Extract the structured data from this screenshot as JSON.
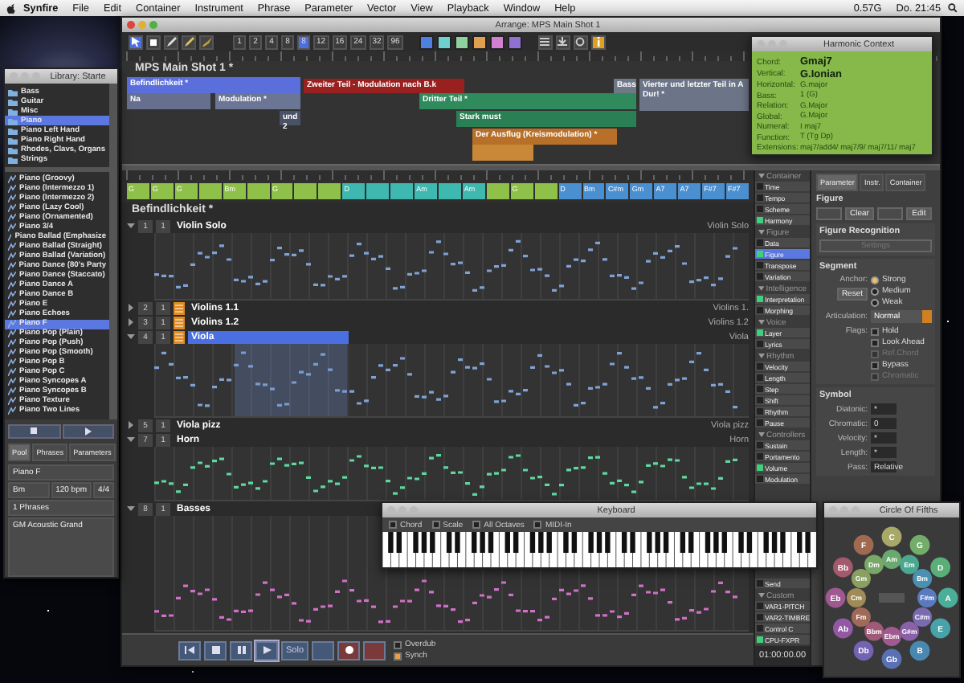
{
  "menu_bar": {
    "app": "Synfire",
    "items": [
      "File",
      "Edit",
      "Container",
      "Instrument",
      "Phrase",
      "Parameter",
      "Vector",
      "View",
      "Playback",
      "Window",
      "Help"
    ],
    "memory": "0.57G",
    "clock": "Do. 21:45"
  },
  "arrange_window": {
    "title": "Arrange: MPS Main Shot 1",
    "toolbar": {
      "quantize": [
        {
          "label": "1",
          "selected": false
        },
        {
          "label": "2",
          "selected": false
        },
        {
          "label": "4",
          "selected": false
        },
        {
          "label": "8",
          "selected": false
        },
        {
          "label": "8",
          "selected": true
        },
        {
          "label": "12",
          "selected": false
        },
        {
          "label": "16",
          "selected": false
        },
        {
          "label": "24",
          "selected": false
        },
        {
          "label": "32",
          "selected": false
        },
        {
          "label": "96",
          "selected": false
        }
      ],
      "color_buttons": [
        {
          "color": "#4f7fe0"
        },
        {
          "color": "#6fd0d0"
        },
        {
          "color": "#8fd0a0"
        },
        {
          "color": "#e0a050"
        },
        {
          "color": "#d080d0"
        },
        {
          "color": "#9070d0"
        }
      ]
    },
    "arrange": {
      "title": "MPS Main Shot 1 *",
      "blocks": [
        {
          "label": "Befindlichkeit *",
          "color": "#5b6fdc"
        },
        {
          "label": "Zweiter Teil - Modulation nach B.k",
          "color": "#9a2020"
        },
        {
          "label": "Na",
          "color": "#66708e"
        },
        {
          "label": "Modulation *",
          "color": "#6b7594"
        },
        {
          "label": "und 2",
          "color": "#4a5266"
        },
        {
          "label": "Dritter Teil *",
          "color": "#2f8a5c"
        },
        {
          "label": "Stark must",
          "color": "#2a7f55"
        },
        {
          "label": "Der Ausflug (Kreismodulation) *",
          "color": "#b87028"
        },
        {
          "label": "Bass",
          "color": "#707888"
        },
        {
          "label": "Vierter und letzter Teil in A Dur! *",
          "color": "#6c7488"
        }
      ]
    },
    "chords": [
      {
        "label": "G",
        "color": "#8fc04a"
      },
      {
        "label": "G",
        "color": "#8fc04a"
      },
      {
        "label": "G",
        "color": "#8fc04a"
      },
      {
        "color": "#8fc04a"
      },
      {
        "label": "Bm",
        "color": "#8fc04a"
      },
      {
        "color": "#8fc04a"
      },
      {
        "label": "G",
        "color": "#8fc04a"
      },
      {
        "color": "#8fc04a"
      },
      {
        "color": "#8fc04a"
      },
      {
        "label": "D",
        "color": "#3fb8b0"
      },
      {
        "color": "#3fb8b0"
      },
      {
        "color": "#3fb8b0"
      },
      {
        "label": "Am",
        "color": "#3fb8b0"
      },
      {
        "color": "#3fb8b0"
      },
      {
        "label": "Am",
        "color": "#3fb8b0"
      },
      {
        "color": "#8fc04a"
      },
      {
        "label": "G",
        "color": "#8fc04a"
      },
      {
        "color": "#8fc04a"
      },
      {
        "label": "D",
        "color": "#4a8fd0"
      },
      {
        "label": "Bm",
        "color": "#4a8fd0"
      },
      {
        "label": "C#m",
        "color": "#4a8fd0"
      },
      {
        "label": "Gm",
        "color": "#4a8fd0"
      },
      {
        "label": "A7",
        "color": "#4a8fd0"
      },
      {
        "label": "A7",
        "color": "#4a8fd0"
      },
      {
        "label": "F#7",
        "color": "#4a8fd0"
      },
      {
        "label": "F#7",
        "color": "#4a8fd0"
      }
    ],
    "section_title": "Befindlichkeit *",
    "tracks": [
      {
        "number": "1",
        "channel": "1",
        "name": "Violin Solo",
        "right_label": "Violin Solo",
        "grouped": false,
        "expanded": true,
        "selected": false,
        "color": "#7fa2d6"
      },
      {
        "number": "2",
        "channel": "1",
        "name": "Violins 1.1",
        "right_label": "Violins 1.",
        "grouped": true,
        "expanded": false,
        "selected": false
      },
      {
        "number": "3",
        "channel": "1",
        "name": "Violins 1.2",
        "right_label": "Violins 1.2",
        "grouped": true,
        "expanded": false,
        "selected": false
      },
      {
        "number": "4",
        "channel": "1",
        "name": "Viola",
        "right_label": "Viola",
        "grouped": true,
        "expanded": true,
        "selected": true,
        "color": "#7fa2d6"
      },
      {
        "number": "5",
        "channel": "1",
        "name": "Viola pizz",
        "right_label": "Viola pizz",
        "grouped": false,
        "expanded": false,
        "selected": false
      },
      {
        "number": "7",
        "channel": "1",
        "name": "Horn",
        "right_label": "Horn",
        "grouped": false,
        "expanded": true,
        "selected": false,
        "color": "#5fd8a0"
      },
      {
        "number": "8",
        "channel": "1",
        "name": "Basses",
        "grouped": false,
        "expanded": true,
        "selected": false,
        "color": "#d070c8"
      }
    ],
    "transport": {
      "buttons": [
        {
          "kind": "start"
        },
        {
          "kind": "stop"
        },
        {
          "kind": "pause"
        },
        {
          "kind": "play"
        },
        {
          "kind": "text",
          "label": "Solo"
        },
        {
          "kind": "blank"
        },
        {
          "kind": "record"
        },
        {
          "kind": "blank-red"
        }
      ],
      "options": [
        {
          "label": "Overdub",
          "checked": false
        },
        {
          "label": "Synch",
          "checked": true
        }
      ]
    },
    "param_list": {
      "sections": [
        {
          "title": "Container",
          "items": [
            {
              "label": "Time",
              "on": false,
              "selected": false
            },
            {
              "label": "Tempo",
              "on": false,
              "selected": false
            },
            {
              "label": "Scheme",
              "on": false,
              "selected": false
            },
            {
              "label": "Harmony",
              "on": true,
              "selected": false
            }
          ]
        },
        {
          "title": "Figure",
          "items": [
            {
              "label": "Data",
              "on": false,
              "selected": false
            },
            {
              "label": "Figure",
              "on": true,
              "selected": true
            },
            {
              "label": "Transpose",
              "on": false,
              "selected": false
            },
            {
              "label": "Variation",
              "on": false,
              "selected": false
            }
          ]
        },
        {
          "title": "Intelligence",
          "items": [
            {
              "label": "Interpretation",
              "on": true,
              "selected": false
            },
            {
              "label": "Morphing",
              "on": false,
              "selected": false
            }
          ]
        },
        {
          "title": "Voice",
          "items": [
            {
              "label": "Layer",
              "on": true,
              "selected": false
            },
            {
              "label": "Lyrics",
              "on": false,
              "selected": false
            }
          ]
        },
        {
          "title": "Rhythm",
          "items": [
            {
              "label": "Velocity",
              "on": false,
              "selected": false
            },
            {
              "label": "Length",
              "on": false,
              "selected": false
            },
            {
              "label": "Step",
              "on": false,
              "selected": false
            },
            {
              "label": "Shift",
              "on": false,
              "selected": false
            },
            {
              "label": "Rhythm",
              "on": false,
              "selected": false
            },
            {
              "label": "Pause",
              "on": false,
              "selected": false
            }
          ]
        },
        {
          "title": "Controllers",
          "items": [
            {
              "label": "Sustain",
              "on": false,
              "selected": false
            },
            {
              "label": "Portamento",
              "on": false,
              "selected": false
            },
            {
              "label": "Volume",
              "on": true,
              "selected": false
            },
            {
              "label": "Modulation",
              "on": false,
              "selected": false
            }
          ]
        }
      ],
      "more": [
        {
          "label": "Send",
          "on": false,
          "selected": false
        }
      ],
      "custom": {
        "title": "Custom",
        "items": [
          {
            "label": "VAR1-PITCH",
            "on": false,
            "selected": false
          },
          {
            "label": "VAR2-TIMBRE",
            "on": false,
            "selected": false
          },
          {
            "label": "Control C",
            "on": false,
            "selected": false
          },
          {
            "label": "CPU-FXPR",
            "on": true,
            "selected": false
          }
        ]
      },
      "time": "01:00:00.00"
    },
    "inspector": {
      "tabs": [
        {
          "label": "Parameter",
          "selected": true
        },
        {
          "label": "Instr.",
          "selected": false
        },
        {
          "label": "Container",
          "selected": false
        }
      ],
      "figure_title": "Figure",
      "figure_buttons": [
        {
          "disabled": true
        },
        {
          "label": "Clear",
          "disabled": false
        },
        {
          "disabled": true
        },
        {
          "label": "Edit",
          "disabled": false
        }
      ],
      "recognition_title": "Figure Recognition",
      "settings_button": "Settings",
      "segment": {
        "title": "Segment",
        "anchor_label": "Anchor:",
        "anchors": [
          {
            "label": "Strong",
            "selected": true
          },
          {
            "label": "Medium",
            "selected": false
          },
          {
            "label": "Weak",
            "selected": false
          }
        ],
        "reset": "Reset",
        "articulation_label": "Articulation:",
        "articulation": "Normal",
        "flags_label": "Flags:",
        "flags": [
          {
            "label": "Hold",
            "checked": false,
            "disabled": false
          },
          {
            "label": "Look Ahead",
            "checked": false,
            "disabled": false
          },
          {
            "label": "Ref.Chord",
            "checked": false,
            "disabled": true
          },
          {
            "label": "Bypass",
            "checked": false,
            "disabled": false
          },
          {
            "label": "Chromatic",
            "checked": false,
            "disabled": true
          }
        ]
      },
      "symbol": {
        "title": "Symbol",
        "fields": [
          {
            "label": "Diatonic:",
            "value": "*"
          },
          {
            "label": "Chromatic:",
            "value": "0"
          },
          {
            "label": "Velocity:",
            "value": "*"
          },
          {
            "label": "Length:",
            "value": "*"
          },
          {
            "label": "Pass:",
            "value": "Relative"
          }
        ]
      }
    }
  },
  "library": {
    "title": "Library: Starte",
    "folders": [
      {
        "label": "Bass",
        "selected": false
      },
      {
        "label": "Guitar",
        "selected": false
      },
      {
        "label": "Misc",
        "selected": false
      },
      {
        "label": "Piano",
        "selected": true
      },
      {
        "label": "Piano Left Hand",
        "selected": false
      },
      {
        "label": "Piano Right Hand",
        "selected": false
      },
      {
        "label": "Rhodes, Clavs, Organs",
        "selected": false
      },
      {
        "label": "Strings",
        "selected": false
      }
    ],
    "phrases": [
      {
        "label": "Piano (Groovy)",
        "selected": false
      },
      {
        "label": "Piano (Intermezzo 1)",
        "selected": false
      },
      {
        "label": "Piano (Intermezzo 2)",
        "selected": false
      },
      {
        "label": "Piano (Lazy Cool)",
        "selected": false
      },
      {
        "label": "Piano (Ornamented)",
        "selected": false
      },
      {
        "label": "Piano 3/4",
        "selected": false
      },
      {
        "label": "Piano Ballad (Emphasize",
        "selected": false
      },
      {
        "label": "Piano Ballad (Straight)",
        "selected": false
      },
      {
        "label": "Piano Ballad (Variation)",
        "selected": false
      },
      {
        "label": "Piano Dance (80's Party",
        "selected": false
      },
      {
        "label": "Piano Dance (Staccato)",
        "selected": false
      },
      {
        "label": "Piano Dance A",
        "selected": false
      },
      {
        "label": "Piano Dance B",
        "selected": false
      },
      {
        "label": "Piano E",
        "selected": false
      },
      {
        "label": "Piano Echoes",
        "selected": false
      },
      {
        "label": "Piano F",
        "selected": true
      },
      {
        "label": "Piano Pop (Plain)",
        "selected": false
      },
      {
        "label": "Piano Pop (Push)",
        "selected": false
      },
      {
        "label": "Piano Pop (Smooth)",
        "selected": false
      },
      {
        "label": "Piano Pop B",
        "selected": false
      },
      {
        "label": "Piano Pop C",
        "selected": false
      },
      {
        "label": "Piano Syncopes A",
        "selected": false
      },
      {
        "label": "Piano Syncopes B",
        "selected": false
      },
      {
        "label": "Piano Texture",
        "selected": false
      },
      {
        "label": "Piano Two Lines",
        "selected": false
      }
    ],
    "tabs": [
      {
        "label": "Pool",
        "selected": true
      },
      {
        "label": "Phrases",
        "selected": false
      },
      {
        "label": "Parameters",
        "selected": false
      }
    ],
    "info": {
      "name": "Piano F",
      "key": "Bm",
      "tempo": "120 bpm",
      "meter": "4/4",
      "phrases": "1 Phrases",
      "sound": "GM Acoustic Grand"
    }
  },
  "harmonic_context": {
    "title": "Harmonic Context",
    "rows": [
      {
        "label": "Chord:",
        "value": "Gmaj7",
        "kind": "strong"
      },
      {
        "label": "Vertical:",
        "value": "G.Ionian",
        "kind": "strong"
      },
      {
        "label": "Horizontal:",
        "value": "G.major",
        "kind": "plain"
      },
      {
        "label": "Bass:",
        "value": "1 (G)",
        "kind": "plain"
      },
      {
        "label": "Relation:",
        "value": "G.Major",
        "kind": "plain"
      },
      {
        "label": "Global:",
        "value": "G.Major",
        "kind": "plain"
      },
      {
        "label": "Numeral:",
        "value": "I maj7",
        "kind": "plain"
      },
      {
        "label": "Function:",
        "value": "T (Tg Dp)",
        "kind": "plain"
      },
      {
        "label": "Extensions:",
        "value": "maj7/add4/ maj7/9/ maj7/11/ maj7",
        "kind": "plain"
      }
    ]
  },
  "keyboard": {
    "title": "Keyboard",
    "options": [
      {
        "label": "Chord",
        "checked": false
      },
      {
        "label": "Scale",
        "checked": false
      },
      {
        "label": "All Octaves",
        "checked": false
      },
      {
        "label": "MIDI-In",
        "checked": false
      }
    ]
  },
  "circle_of_fifths": {
    "title": "Circle Of Fifths",
    "major": [
      {
        "label": "C",
        "color": "#a8a868"
      },
      {
        "label": "G",
        "color": "#72ae6a"
      },
      {
        "label": "D",
        "color": "#5aae78"
      },
      {
        "label": "A",
        "color": "#4aae98"
      },
      {
        "label": "E",
        "color": "#48a2aa"
      },
      {
        "label": "B",
        "color": "#4a88b2"
      },
      {
        "label": "Gb",
        "color": "#5a70b4"
      },
      {
        "label": "Db",
        "color": "#7462b2"
      },
      {
        "label": "Ab",
        "color": "#9258a4"
      },
      {
        "label": "Eb",
        "color": "#a05890"
      },
      {
        "label": "Bb",
        "color": "#a25a6c"
      },
      {
        "label": "F",
        "color": "#a06a52"
      }
    ],
    "minor": [
      {
        "label": "Am",
        "color": "#6aa870"
      },
      {
        "label": "Em",
        "color": "#4aa890"
      },
      {
        "label": "Bm",
        "color": "#4a90b0"
      },
      {
        "label": "F#m",
        "color": "#5a7ac0"
      },
      {
        "label": "C#m",
        "color": "#7a6ab0"
      },
      {
        "label": "G#m",
        "color": "#8a60a8"
      },
      {
        "label": "Ebm",
        "color": "#a05a90"
      },
      {
        "label": "Bbm",
        "color": "#a05a78"
      },
      {
        "label": "Fm",
        "color": "#a06a58"
      },
      {
        "label": "Cm",
        "color": "#a08a58"
      },
      {
        "label": "Gm",
        "color": "#8aa060"
      },
      {
        "label": "Dm",
        "color": "#78a868"
      }
    ]
  }
}
